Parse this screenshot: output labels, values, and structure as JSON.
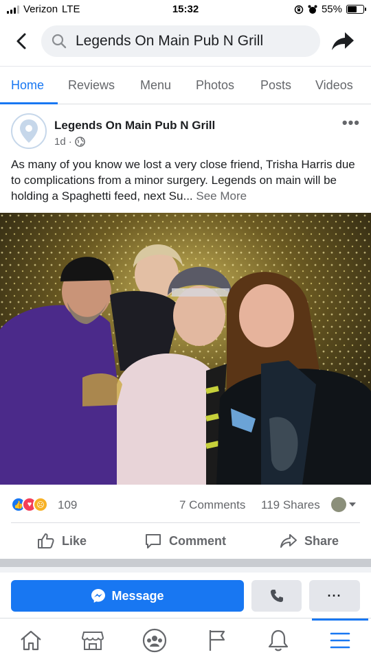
{
  "status_bar": {
    "carrier": "Verizon",
    "network": "LTE",
    "time": "15:32",
    "battery_percent": "55%",
    "battery_level": 0.55
  },
  "search": {
    "query": "Legends On Main Pub N Grill"
  },
  "tabs": [
    {
      "label": "Home",
      "active": true
    },
    {
      "label": "Reviews",
      "active": false
    },
    {
      "label": "Menu",
      "active": false
    },
    {
      "label": "Photos",
      "active": false
    },
    {
      "label": "Posts",
      "active": false
    },
    {
      "label": "Videos",
      "active": false
    }
  ],
  "post": {
    "page_name": "Legends On Main Pub N Grill",
    "time_ago": "1d",
    "separator": "·",
    "text": "As many of you know we lost a very close friend, Trisha Harris due to complications from a minor surgery.  Legends on main will be holding a Spaghetti feed, next Su...",
    "see_more": "See More",
    "reaction_count": "109",
    "comments": "7 Comments",
    "shares": "119 Shares"
  },
  "actions": {
    "like": "Like",
    "comment": "Comment",
    "share": "Share"
  },
  "page_buttons": {
    "message": "Message",
    "more": "···"
  },
  "colors": {
    "accent": "#1877f2",
    "text": "#1c1e21",
    "secondary_text": "#65676b",
    "button_gray": "#e4e6eb"
  },
  "icons": {
    "back": "chevron-left-icon",
    "search": "search-icon",
    "share_top": "share-arrow-icon",
    "globe": "globe-icon",
    "location": "location-pin-icon",
    "nav": [
      "home-icon",
      "marketplace-icon",
      "groups-icon",
      "pages-flag-icon",
      "notifications-bell-icon",
      "menu-icon"
    ]
  }
}
